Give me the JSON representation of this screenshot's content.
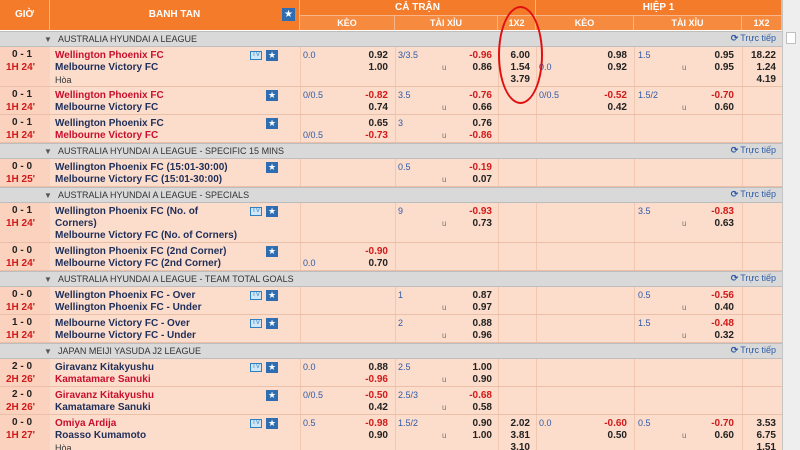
{
  "header": {
    "time_label": "GIỜ",
    "match_label": "BANH TAN",
    "full_time_label": "CẢ TRẬN",
    "first_half_label": "HIỆP 1",
    "handicap_label": "KÈO",
    "over_under_label": "TÀI XỈU",
    "one_x_two_label": "1X2"
  },
  "icons": {
    "star": "★",
    "tv": "TV",
    "live": "⟳"
  },
  "under_symbol": "u",
  "colors": {
    "accent": "#f47b2a",
    "favorite": "#c8102e",
    "underdog": "#1e2f5a",
    "negative": "#d11a1a",
    "highlight": "#e01010"
  },
  "blocks": [
    {
      "type": "league",
      "name": "AUSTRALIA HYUNDAI A LEAGUE",
      "live_label": "Trực tiếp"
    },
    {
      "type": "match",
      "score": "0 - 1",
      "clock": "1H 24'",
      "home": "Wellington Phoenix FC",
      "away": "Melbourne Victory FC",
      "draw_label": "Hòa",
      "home_fav": true,
      "away_fav": false,
      "tv": true,
      "ft_hdp": "0.0",
      "ft_hdp_row": 1,
      "ft_home": "0.92",
      "ft_away": "1.00",
      "ft_ou": "3/3.5",
      "ft_over": "-0.96",
      "ft_under": "0.86",
      "ft_1x2": [
        "6.00",
        "1.54",
        "3.79"
      ],
      "h1_hdp": "0.0",
      "h1_hdp_row": 2,
      "h1_home": "0.98",
      "h1_away": "0.92",
      "h1_ou": "1.5",
      "h1_over": "0.95",
      "h1_under": "0.95",
      "h1_1x2": [
        "18.22",
        "1.24",
        "4.19"
      ]
    },
    {
      "type": "match",
      "score": "0 - 1",
      "clock": "1H 24'",
      "home": "Wellington Phoenix FC",
      "away": "Melbourne Victory FC",
      "home_fav": true,
      "away_fav": false,
      "tv": false,
      "ft_hdp": "0/0.5",
      "ft_hdp_row": 1,
      "ft_home": "-0.82",
      "ft_away": "0.74",
      "ft_ou": "3.5",
      "ft_over": "-0.76",
      "ft_under": "0.66",
      "h1_hdp": "0/0.5",
      "h1_hdp_row": 1,
      "h1_home": "-0.52",
      "h1_away": "0.42",
      "h1_ou": "1.5/2",
      "h1_over": "-0.70",
      "h1_under": "0.60"
    },
    {
      "type": "match",
      "score": "0 - 1",
      "clock": "1H 24'",
      "home": "Wellington Phoenix FC",
      "away": "Melbourne Victory FC",
      "home_fav": false,
      "away_fav": true,
      "tv": false,
      "ft_hdp": "0/0.5",
      "ft_hdp_row": 2,
      "ft_home": "0.65",
      "ft_away": "-0.73",
      "ft_ou": "3",
      "ft_over": "0.76",
      "ft_under": "-0.86"
    },
    {
      "type": "league",
      "name": "AUSTRALIA HYUNDAI A LEAGUE - SPECIFIC 15 MINS",
      "live_label": "Trực tiếp"
    },
    {
      "type": "match",
      "score": "0 - 0",
      "clock": "1H 25'",
      "home": "Wellington Phoenix FC (15:01-30:00)",
      "away": "Melbourne Victory FC (15:01-30:00)",
      "home_fav": false,
      "away_fav": false,
      "tv": false,
      "ft_ou": "0.5",
      "ft_over": "-0.19",
      "ft_under": "0.07"
    },
    {
      "type": "league",
      "name": "AUSTRALIA HYUNDAI A LEAGUE - SPECIALS",
      "live_label": "Trực tiếp"
    },
    {
      "type": "match",
      "score": "0 - 1",
      "clock": "1H 24'",
      "home": "Wellington Phoenix FC (No. of Corners)",
      "away": "Melbourne Victory FC (No. of Corners)",
      "home_wrap": true,
      "home_fav": false,
      "away_fav": false,
      "tv": true,
      "ft_ou": "9",
      "ft_over": "-0.93",
      "ft_under": "0.73",
      "h1_ou": "3.5",
      "h1_over": "-0.83",
      "h1_under": "0.63"
    },
    {
      "type": "match",
      "score": "0 - 0",
      "clock": "1H 24'",
      "home": "Wellington Phoenix FC (2nd Corner)",
      "away": "Melbourne Victory FC (2nd Corner)",
      "home_fav": false,
      "away_fav": false,
      "tv": false,
      "ft_hdp": "0.0",
      "ft_hdp_row": 2,
      "ft_home": "-0.90",
      "ft_away": "0.70"
    },
    {
      "type": "league",
      "name": "AUSTRALIA HYUNDAI A LEAGUE - TEAM TOTAL GOALS",
      "live_label": "Trực tiếp"
    },
    {
      "type": "match",
      "score": "0 - 0",
      "clock": "1H 24'",
      "home": "Wellington Phoenix FC - Over",
      "away": "Wellington Phoenix FC - Under",
      "home_fav": false,
      "away_fav": false,
      "tv": true,
      "ft_ou": "1",
      "ft_over": "0.87",
      "ft_under": "0.97",
      "h1_ou": "0.5",
      "h1_over": "-0.56",
      "h1_under": "0.40"
    },
    {
      "type": "match",
      "score": "1 - 0",
      "clock": "1H 24'",
      "home": "Melbourne Victory FC - Over",
      "away": "Melbourne Victory FC - Under",
      "home_fav": false,
      "away_fav": false,
      "tv": true,
      "ft_ou": "2",
      "ft_over": "0.88",
      "ft_under": "0.96",
      "h1_ou": "1.5",
      "h1_over": "-0.48",
      "h1_under": "0.32"
    },
    {
      "type": "league",
      "name": "JAPAN MEIJI YASUDA J2 LEAGUE",
      "live_label": "Trực tiếp"
    },
    {
      "type": "match",
      "score": "2 - 0",
      "clock": "2H 26'",
      "home": "Giravanz Kitakyushu",
      "away": "Kamatamare Sanuki",
      "home_fav": false,
      "away_fav": true,
      "tv": true,
      "ft_hdp": "0.0",
      "ft_hdp_row": 1,
      "ft_home": "0.88",
      "ft_away": "-0.96",
      "ft_ou": "2.5",
      "ft_over": "1.00",
      "ft_under": "0.90"
    },
    {
      "type": "match",
      "score": "2 - 0",
      "clock": "2H 26'",
      "home": "Giravanz Kitakyushu",
      "away": "Kamatamare Sanuki",
      "home_fav": true,
      "away_fav": false,
      "tv": false,
      "ft_hdp": "0/0.5",
      "ft_hdp_row": 1,
      "ft_home": "-0.50",
      "ft_away": "0.42",
      "ft_ou": "2.5/3",
      "ft_over": "-0.68",
      "ft_under": "0.58"
    },
    {
      "type": "match",
      "score": "0 - 0",
      "clock": "1H 27'",
      "home": "Omiya Ardija",
      "away": "Roasso Kumamoto",
      "draw_label": "Hòa",
      "home_fav": true,
      "away_fav": false,
      "tv": true,
      "ft_hdp": "0.5",
      "ft_hdp_row": 1,
      "ft_home": "-0.98",
      "ft_away": "0.90",
      "ft_ou": "1.5/2",
      "ft_over": "0.90",
      "ft_under": "1.00",
      "ft_1x2": [
        "2.02",
        "3.81",
        "3.10"
      ],
      "h1_hdp": "0.0",
      "h1_hdp_row": 1,
      "h1_home": "-0.60",
      "h1_away": "0.50",
      "h1_ou": "0.5",
      "h1_over": "-0.70",
      "h1_under": "0.60",
      "h1_1x2": [
        "3.53",
        "6.75",
        "1.51"
      ]
    }
  ]
}
